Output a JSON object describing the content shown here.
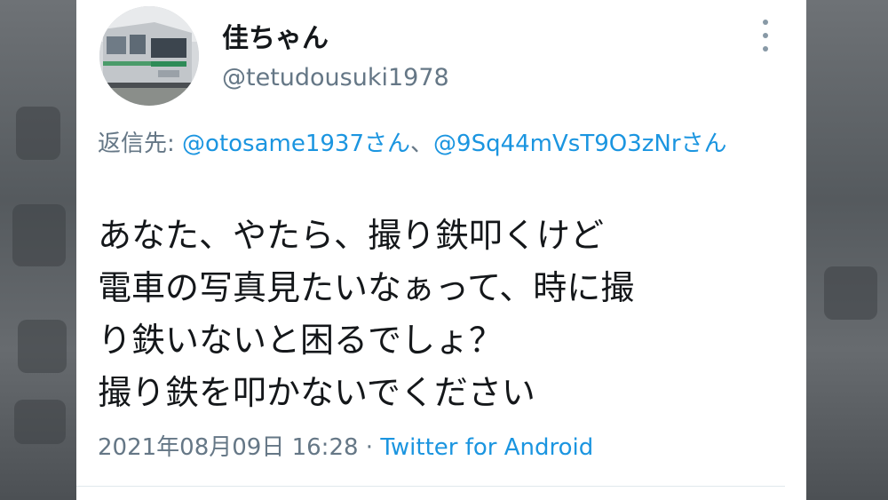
{
  "user": {
    "display_name": "佳ちゃん",
    "handle": "@tetudousuki1978"
  },
  "reply": {
    "prefix": "返信先: ",
    "mention_1": "@otosame1937さん",
    "separator": "、",
    "mention_2": "@9Sq44mVsT9O3zNrさん"
  },
  "tweet": {
    "lines": [
      "あなた、やたら、撮り鉄叩くけど",
      "電車の写真見たいなぁって、時に撮",
      "り鉄いないと困るでしょ？",
      "撮り鉄を叩かないでください"
    ]
  },
  "meta": {
    "timestamp": "2021年08月09日 16:28",
    "dot": " · ",
    "source": "Twitter for Android"
  },
  "colors": {
    "accent": "#1b95e0",
    "secondary_text": "#657786",
    "primary_text": "#14171a"
  },
  "icons": {
    "more": "more-vertical-icon"
  }
}
